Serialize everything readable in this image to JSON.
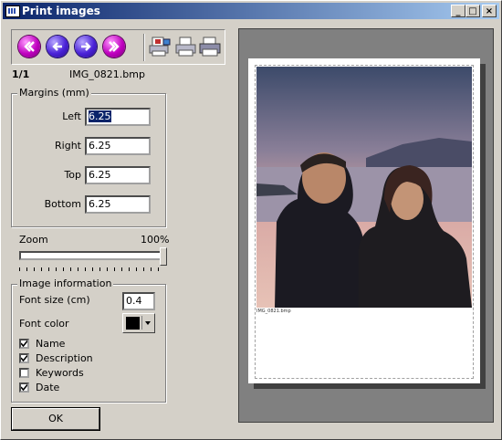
{
  "window": {
    "title": "Print images"
  },
  "titlebar_buttons": {
    "minimize": "_",
    "maximize": "□",
    "close": "×"
  },
  "toolbar": {
    "buttons": [
      {
        "name": "first-button",
        "icon": "double-arrow-left-icon",
        "color": "#c000c0"
      },
      {
        "name": "previous-button",
        "icon": "arrow-left-icon",
        "color": "#4a22d8"
      },
      {
        "name": "next-button",
        "icon": "arrow-right-icon",
        "color": "#4a22d8"
      },
      {
        "name": "last-button",
        "icon": "double-arrow-right-icon",
        "color": "#c000c0"
      }
    ],
    "print_buttons": [
      "print-setup-icon",
      "printer-icon",
      "print-icon"
    ]
  },
  "status": {
    "counter": "1/1",
    "filename": "IMG_0821.bmp"
  },
  "margins": {
    "legend": "Margins (mm)",
    "left_label": "Left",
    "left_value": "6.25",
    "right_label": "Right",
    "right_value": "6.25",
    "top_label": "Top",
    "top_value": "6.25",
    "bottom_label": "Bottom",
    "bottom_value": "6.25"
  },
  "zoom": {
    "label": "Zoom",
    "value_text": "100%",
    "level_percent": 100
  },
  "image_info": {
    "legend": "Image information",
    "font_size_label": "Font size (cm)",
    "font_size_value": "0.4",
    "font_color_label": "Font color",
    "font_color": "#000000",
    "checkboxes": [
      {
        "label": "Name",
        "checked": true
      },
      {
        "label": "Description",
        "checked": true
      },
      {
        "label": "Keywords",
        "checked": false
      },
      {
        "label": "Date",
        "checked": true
      }
    ]
  },
  "ok_label": "OK",
  "preview": {
    "caption": "IMG_0821.bmp"
  }
}
